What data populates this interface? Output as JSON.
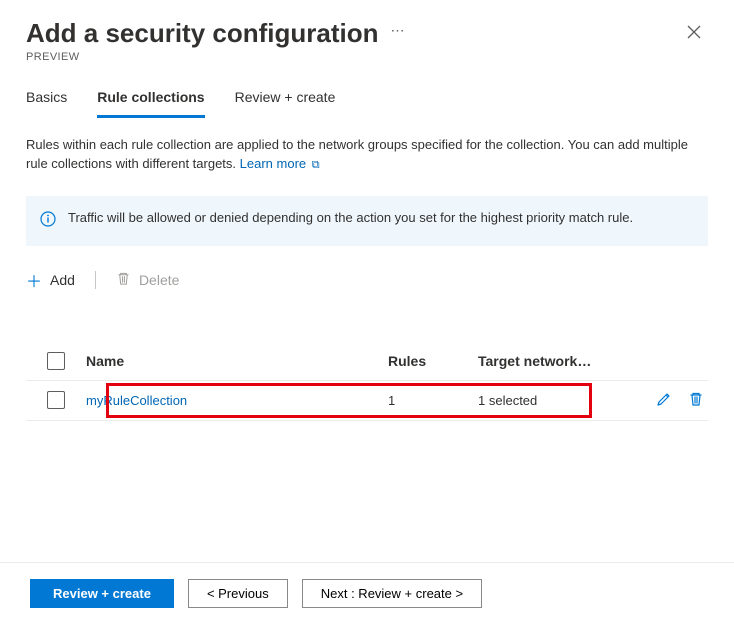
{
  "header": {
    "title": "Add a security configuration",
    "preview": "PREVIEW",
    "ellipsis": "⋯"
  },
  "tabs": {
    "basics": "Basics",
    "rule_collections": "Rule collections",
    "review_create": "Review + create"
  },
  "desc": {
    "line1": "Rules within each rule collection are applied to the network groups specified for the collection. You can add multiple rule collections with different targets. ",
    "learn_more": "Learn more"
  },
  "info": {
    "text": "Traffic will be allowed or denied depending on the action you set for the highest priority match rule."
  },
  "toolbar": {
    "add": "Add",
    "delete": "Delete"
  },
  "table": {
    "headers": {
      "name": "Name",
      "rules": "Rules",
      "target": "Target network…"
    },
    "row": {
      "name": "myRuleCollection",
      "rules": "1",
      "target": "1 selected"
    }
  },
  "footer": {
    "review_create": "Review + create",
    "previous": "< Previous",
    "next": "Next : Review + create >"
  }
}
